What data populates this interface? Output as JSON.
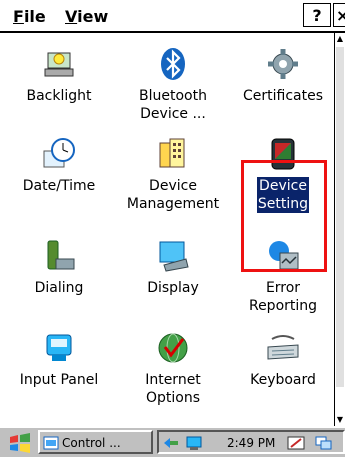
{
  "menubar": {
    "file": {
      "accel": "F",
      "rest": "ile"
    },
    "view": {
      "accel": "V",
      "rest": "iew"
    },
    "help_label": "?",
    "close_label": "×"
  },
  "tiles": [
    {
      "name": "Backlight",
      "lines": [
        "Backlight"
      ],
      "icon": "backlight-icon"
    },
    {
      "name": "Bluetooth Device",
      "lines": [
        "Bluetooth",
        "Device ..."
      ],
      "icon": "bluetooth-icon"
    },
    {
      "name": "Certificates",
      "lines": [
        "Certificates"
      ],
      "icon": "certificates-icon"
    },
    {
      "name": "Date/Time",
      "lines": [
        "Date/Time"
      ],
      "icon": "datetime-icon"
    },
    {
      "name": "Device Management",
      "lines": [
        "Device",
        "Management"
      ],
      "icon": "device-management-icon"
    },
    {
      "name": "Device Setting",
      "lines": [
        "Device",
        "Setting"
      ],
      "icon": "device-setting-icon",
      "selected": true
    },
    {
      "name": "Dialing",
      "lines": [
        "Dialing"
      ],
      "icon": "dialing-icon"
    },
    {
      "name": "Display",
      "lines": [
        "Display"
      ],
      "icon": "display-icon"
    },
    {
      "name": "Error Reporting",
      "lines": [
        "Error",
        "Reporting"
      ],
      "icon": "error-reporting-icon"
    },
    {
      "name": "Input Panel",
      "lines": [
        "Input Panel"
      ],
      "icon": "input-panel-icon"
    },
    {
      "name": "Internet Options",
      "lines": [
        "Internet",
        "Options"
      ],
      "icon": "internet-options-icon"
    },
    {
      "name": "Keyboard",
      "lines": [
        "Keyboard"
      ],
      "icon": "keyboard-icon"
    }
  ],
  "taskbar": {
    "task_label": "Control ...",
    "clock": "2:49 PM"
  },
  "colors": {
    "selection": "#0a246a",
    "highlight_box": "#e11111",
    "taskbar": "#c0c0c0"
  }
}
